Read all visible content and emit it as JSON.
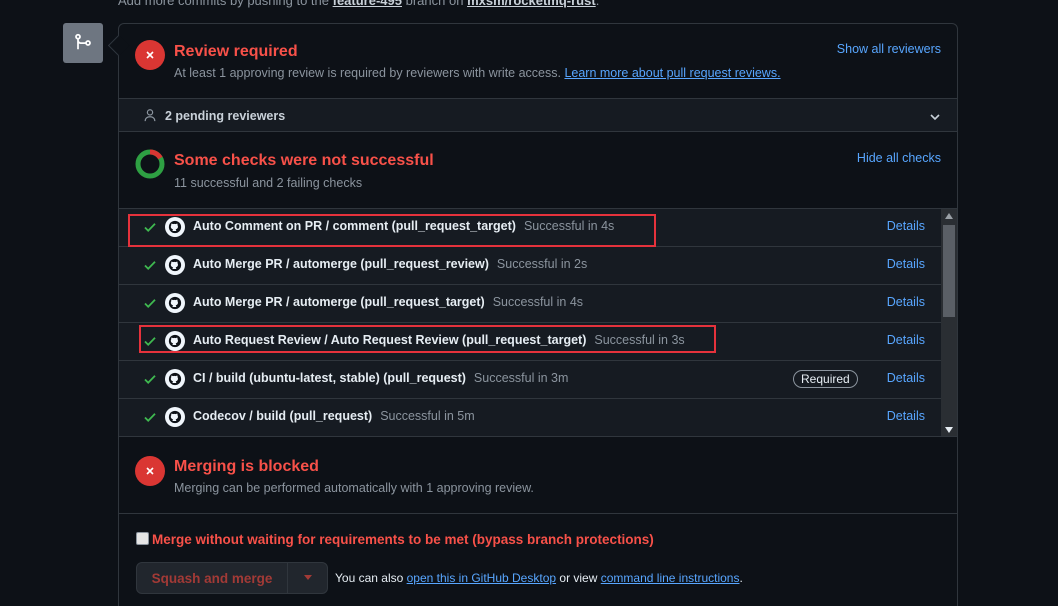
{
  "top_hint": {
    "prefix": "Add more commits by pushing to the",
    "branch": "feature-495",
    "middle": "branch on",
    "repo": "mxsm/rocketmq-rust",
    "suffix": "."
  },
  "review": {
    "title": "Review required",
    "description": "At least 1 approving review is required by reviewers with write access.",
    "learn_more": "Learn more about pull request reviews.",
    "show_all": "Show all reviewers",
    "pending": "2 pending reviewers"
  },
  "checks": {
    "title": "Some checks were not successful",
    "summary": "11 successful and 2 failing checks",
    "hide_all": "Hide all checks",
    "details_label": "Details",
    "required_label": "Required",
    "items": [
      {
        "name": "Auto Comment on PR / comment (pull_request_target)",
        "status": "Successful in 4s"
      },
      {
        "name": "Auto Merge PR / automerge (pull_request_review)",
        "status": "Successful in 2s"
      },
      {
        "name": "Auto Merge PR / automerge (pull_request_target)",
        "status": "Successful in 4s"
      },
      {
        "name": "Auto Request Review / Auto Request Review (pull_request_target)",
        "status": "Successful in 3s"
      },
      {
        "name": "CI / build (ubuntu-latest, stable) (pull_request)",
        "status": "Successful in 3m"
      },
      {
        "name": "Codecov / build (pull_request)",
        "status": "Successful in 5m"
      }
    ]
  },
  "merging": {
    "title": "Merging is blocked",
    "description": "Merging can be performed automatically with 1 approving review.",
    "bypass_label": "Merge without waiting for requirements to be met (bypass branch protections)",
    "button_label": "Squash and merge",
    "also_prefix": "You can also",
    "desktop_link": "open this in GitHub Desktop",
    "or_view": "or view",
    "cli_link": "command line instructions",
    "also_suffix": "."
  },
  "colors": {
    "error": "#f85149",
    "success": "#3fb950",
    "link": "#58a6ff",
    "highlight": "#e5323c"
  }
}
